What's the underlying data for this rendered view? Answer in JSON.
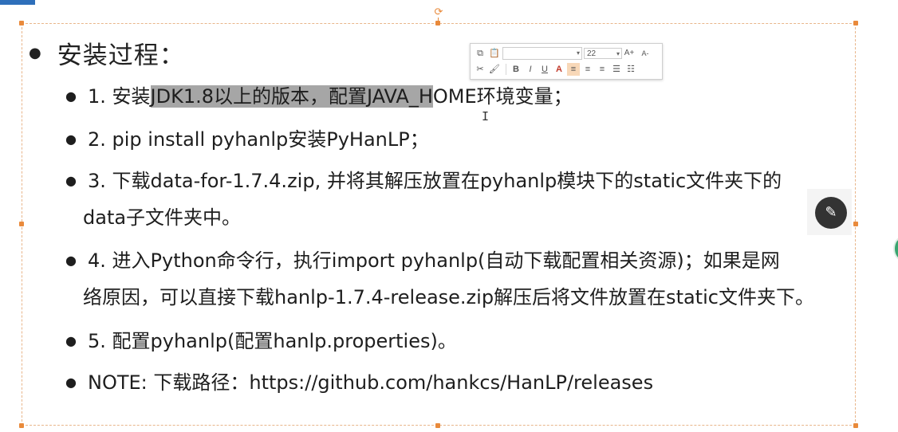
{
  "slide": {
    "heading": "安装过程：",
    "items": [
      {
        "before": "1. 安装",
        "highlight": "JDK1.8以上的版本，配置JAVA_H",
        "after": "OME环境变量；"
      },
      {
        "line1": "2. pip install pyhanlp安装PyHanLP；"
      },
      {
        "line1": "3. 下载data-for-1.7.4.zip, 并将其解压放置在pyhanlp模块下的static文件夹下的",
        "line2": "data子文件夹中。"
      },
      {
        "line1": "4. 进入Python命令行，执行import pyhanlp(自动下载配置相关资源)；如果是网",
        "line2": "络原因，可以直接下载hanlp-1.7.4-release.zip解压后将文件放置在static文件夹下。"
      },
      {
        "line1": "5. 配置pyhanlp(配置hanlp.properties)。"
      },
      {
        "line1": "NOTE: 下载路径：https://github.com/hankcs/HanLP/releases"
      }
    ]
  },
  "mini_toolbar": {
    "font_name": "",
    "font_size": "22",
    "row1_icons": [
      "copy-icon",
      "paste-icon"
    ],
    "grow_font_label": "A+",
    "shrink_font_label": "A-",
    "bold_label": "B",
    "italic_label": "I",
    "underline_label": "U",
    "font_color_label": "A",
    "font_color": "#c23a2b"
  },
  "icons": {
    "pen": "pen-icon",
    "rotate": "rotate-icon"
  },
  "colors": {
    "selection_handles": "#e98a3b",
    "frame_border": "#e8b58a",
    "text_highlight": "#a6a6a6",
    "pen_button": "#333333",
    "corner_tab": "#2e6fba"
  }
}
